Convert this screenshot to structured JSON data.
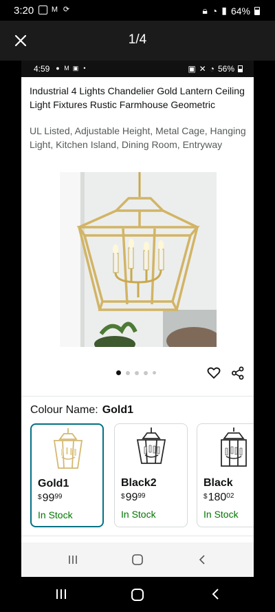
{
  "outer_status": {
    "time": "3:20",
    "battery": "64%"
  },
  "viewer": {
    "counter": "1/4"
  },
  "inner_status": {
    "time": "4:59",
    "battery": "56%"
  },
  "product": {
    "title": "Industrial 4 Lights Chandelier Gold Lantern Ceiling Light Fixtures Rustic Farmhouse Geometric",
    "subtitle": "UL Listed, Adjustable Height, Metal Cage, Hanging Light, Kitchen Island, Dining Room, Entryway",
    "image_dots": {
      "total": 5,
      "active": 1
    }
  },
  "colour": {
    "label": "Colour Name:",
    "selected": "Gold1"
  },
  "swatches": [
    {
      "name": "Gold1",
      "currency": "$",
      "whole": "99",
      "fraction": "99",
      "stock": "In Stock",
      "finish": "#d4b870",
      "selected": true
    },
    {
      "name": "Black2",
      "currency": "$",
      "whole": "99",
      "fraction": "99",
      "stock": "In Stock",
      "finish": "#2a2a2a",
      "selected": false
    },
    {
      "name": "Black",
      "currency": "$",
      "whole": "180",
      "fraction": "02",
      "stock": "In Stock",
      "finish": "#2a2a2a",
      "selected": false
    }
  ],
  "colors": {
    "stock_green": "#007600",
    "selected_border": "#007185"
  }
}
